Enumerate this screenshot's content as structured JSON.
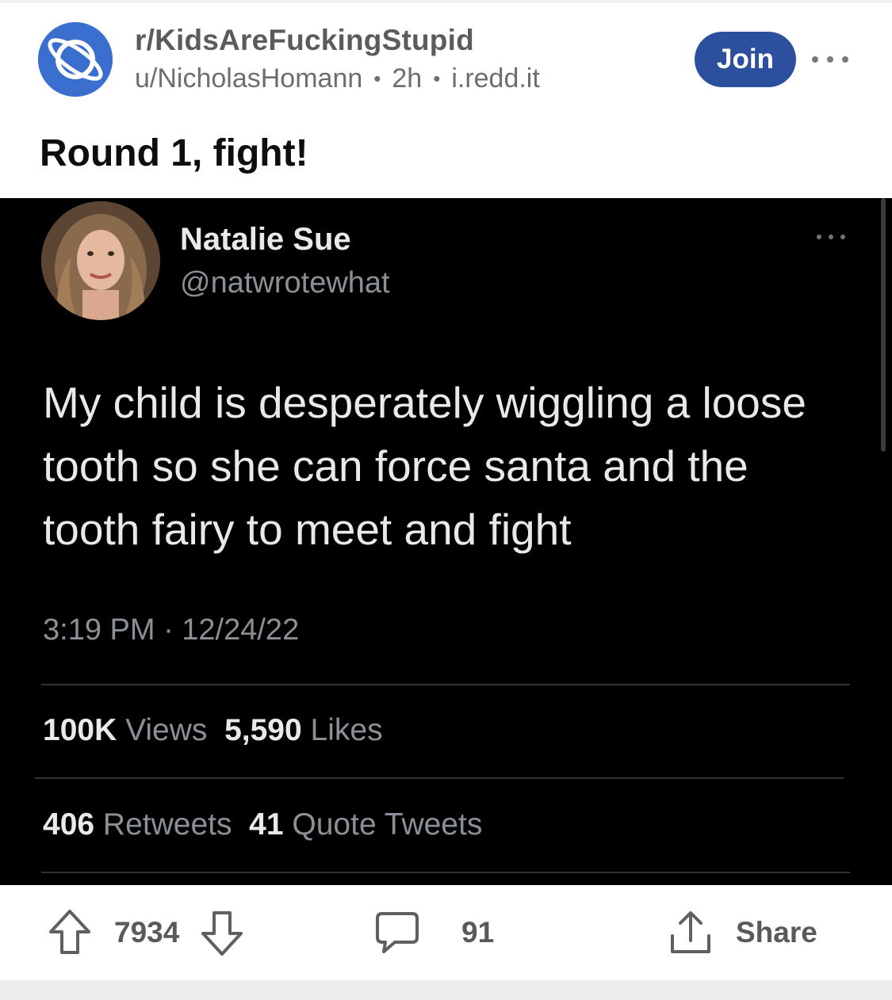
{
  "post": {
    "subreddit": "r/KidsAreFuckingStupid",
    "author": "u/NicholasHomann",
    "age": "2h",
    "domain": "i.redd.it",
    "join_label": "Join",
    "title": "Round 1, fight!"
  },
  "tweet": {
    "name": "Natalie Sue",
    "handle": "@natwrotewhat",
    "text": "My child is desperately wiggling a loose tooth so she can force santa and the tooth fairy to meet and fight",
    "timestamp": "3:19 PM · 12/24/22",
    "views_count": "100K",
    "views_label": "Views",
    "likes_count": "5,590",
    "likes_label": "Likes",
    "retweets_count": "406",
    "retweets_label": "Retweets",
    "quotes_count": "41",
    "quotes_label": "Quote Tweets"
  },
  "actions": {
    "score": "7934",
    "comments": "91",
    "share_label": "Share"
  },
  "colors": {
    "join_button": "#2c4f9e",
    "subreddit_icon": "#3a6fcf",
    "tweet_background": "#000000"
  }
}
